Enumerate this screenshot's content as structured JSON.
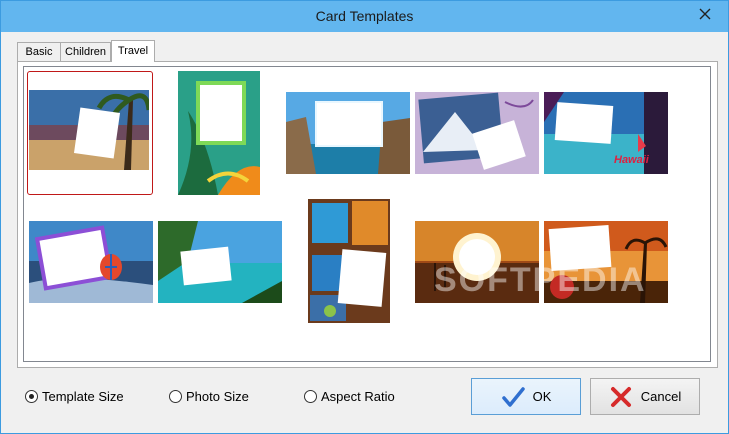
{
  "window": {
    "title": "Card Templates"
  },
  "tabs": [
    {
      "label": "Basic"
    },
    {
      "label": "Children"
    },
    {
      "label": "Travel"
    }
  ],
  "templates": [
    {
      "name": "palm-beach-card"
    },
    {
      "name": "tropical-leaves-card"
    },
    {
      "name": "arch-rock-coast-card"
    },
    {
      "name": "snow-mountain-card"
    },
    {
      "name": "hawaii-sunset-card"
    },
    {
      "name": "hot-air-balloon-card"
    },
    {
      "name": "lagoon-island-card"
    },
    {
      "name": "beach-collage-card"
    },
    {
      "name": "sunset-pier-card"
    },
    {
      "name": "palm-sunset-card"
    }
  ],
  "hawaii_label": "Hawaii",
  "watermark": "SOFTPEDIA",
  "options": {
    "template_size": "Template Size",
    "photo_size": "Photo Size",
    "aspect_ratio": "Aspect Ratio",
    "selected": "template_size"
  },
  "buttons": {
    "ok": "OK",
    "cancel": "Cancel"
  },
  "colors": {
    "titlebar": "#62b6ef",
    "selection": "#c01818"
  }
}
